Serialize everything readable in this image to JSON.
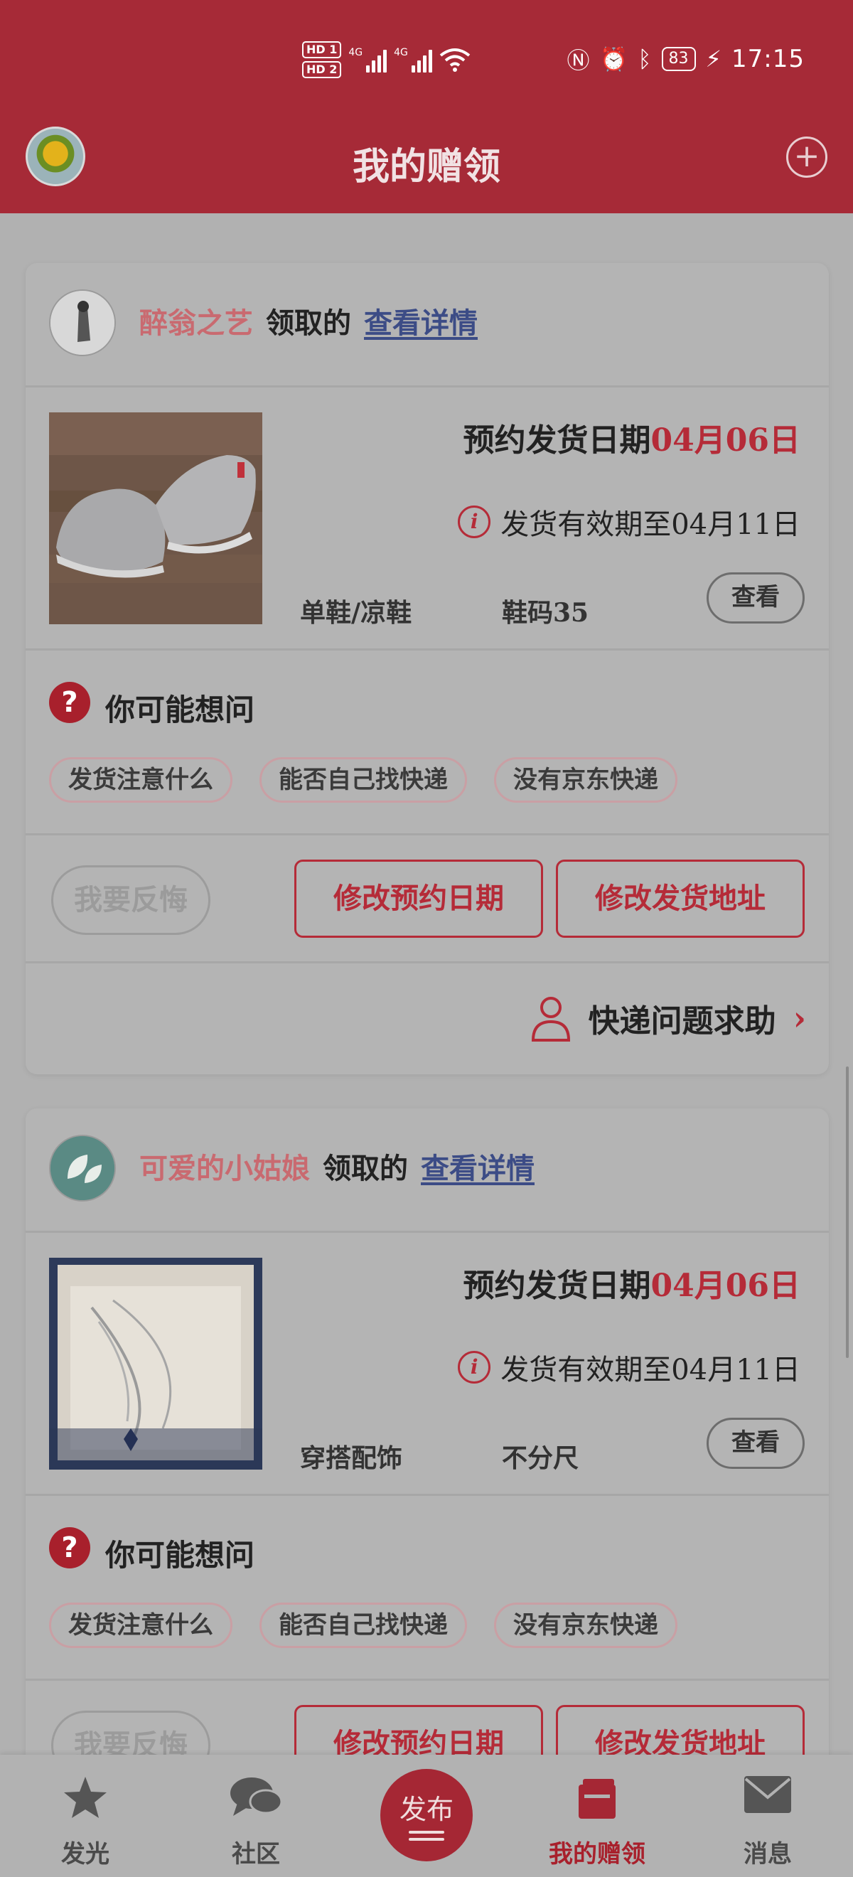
{
  "status_bar": {
    "hd1": "HD 1",
    "hd2": "HD 2",
    "net1": "4G",
    "net2": "4G",
    "battery": "83",
    "time": "17:15"
  },
  "header": {
    "title": "我的赠领",
    "add_icon": "plus-circle-icon"
  },
  "cards": [
    {
      "giver_name": "醉翁之艺",
      "giver_verb": "领取的",
      "view_detail": "查看详情",
      "ship_label": "预约发货日期",
      "ship_date": "04月06日",
      "valid_text": "发货有效期至04月11日",
      "category": "单鞋/凉鞋",
      "size": "鞋码35",
      "look": "查看",
      "faq_title": "你可能想问",
      "chips": [
        "发货注意什么",
        "能否自己找快递",
        "没有京东快递"
      ],
      "regret": "我要反悔",
      "change_date": "修改预约日期",
      "change_addr": "修改发货地址",
      "help": "快递问题求助"
    },
    {
      "giver_name": "可爱的小姑娘",
      "giver_verb": "领取的",
      "view_detail": "查看详情",
      "ship_label": "预约发货日期",
      "ship_date": "04月06日",
      "valid_text": "发货有效期至04月11日",
      "category": "穿搭配饰",
      "size": "不分尺",
      "look": "查看",
      "faq_title": "你可能想问",
      "chips": [
        "发货注意什么",
        "能否自己找快递",
        "没有京东快递"
      ],
      "regret": "我要反悔",
      "change_date": "修改预约日期",
      "change_addr": "修改发货地址"
    }
  ],
  "bottom_nav": {
    "items": [
      {
        "label": "发光",
        "icon": "star-icon"
      },
      {
        "label": "社区",
        "icon": "chat-bubbles-icon"
      },
      {
        "label": "我的赠领",
        "icon": "gift-box-icon"
      },
      {
        "label": "消息",
        "icon": "envelope-icon"
      }
    ],
    "publish_label": "发布",
    "active": "我的赠领"
  },
  "colors": {
    "brand_red": "#a62a37",
    "accent_red": "#b52b38",
    "link_blue": "#3c4c86"
  }
}
